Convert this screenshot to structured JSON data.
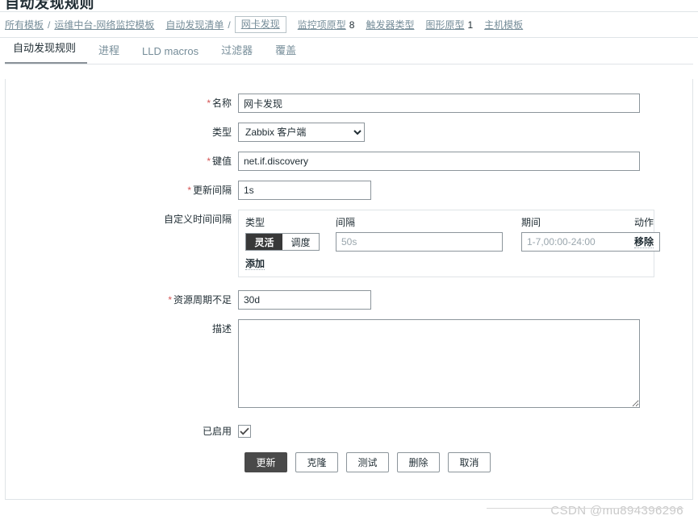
{
  "page": {
    "title": "自动发现规则"
  },
  "breadcrumb": {
    "items": [
      {
        "label": "所有模板",
        "link": true,
        "boxed": false,
        "count": ""
      },
      {
        "label": "运维中台-网络监控模板",
        "link": true,
        "boxed": false,
        "count": ""
      },
      {
        "label": "自动发现清单",
        "link": true,
        "boxed": false,
        "count": ""
      },
      {
        "label": "网卡发现",
        "link": true,
        "boxed": true,
        "count": ""
      },
      {
        "label": "监控项原型",
        "link": true,
        "boxed": false,
        "count": "8"
      },
      {
        "label": "触发器类型",
        "link": true,
        "boxed": false,
        "count": ""
      },
      {
        "label": "图形原型",
        "link": true,
        "boxed": false,
        "count": "1"
      },
      {
        "label": "主机模板",
        "link": true,
        "boxed": false,
        "count": ""
      }
    ],
    "separator": "/"
  },
  "tabs": [
    {
      "label": "自动发现规则",
      "active": true
    },
    {
      "label": "进程",
      "active": false
    },
    {
      "label": "LLD macros",
      "active": false
    },
    {
      "label": "过滤器",
      "active": false
    },
    {
      "label": "覆盖",
      "active": false
    }
  ],
  "form": {
    "name": {
      "label": "名称",
      "required": true,
      "value": "网卡发现",
      "placeholder": ""
    },
    "type": {
      "label": "类型",
      "required": false,
      "value": "Zabbix 客户端",
      "options": [
        "Zabbix 客户端"
      ]
    },
    "key": {
      "label": "键值",
      "required": true,
      "value": "net.if.discovery",
      "placeholder": ""
    },
    "update_interval": {
      "label": "更新间隔",
      "required": true,
      "value": "1s",
      "placeholder": ""
    },
    "custom_intervals": {
      "label": "自定义时间间隔",
      "headers": {
        "type": "类型",
        "interval": "间隔",
        "period": "期间",
        "action": "动作"
      },
      "rows": [
        {
          "type_options": [
            "灵活",
            "调度"
          ],
          "type_selected": "灵活",
          "interval_value": "",
          "interval_placeholder": "50s",
          "period_value": "",
          "period_placeholder": "1-7,00:00-24:00",
          "remove_label": "移除"
        }
      ],
      "add_label": "添加"
    },
    "lifetime": {
      "label": "资源周期不足",
      "required": true,
      "value": "30d",
      "placeholder": ""
    },
    "description": {
      "label": "描述",
      "required": false,
      "value": "",
      "placeholder": ""
    },
    "enabled": {
      "label": "已启用",
      "checked": true
    }
  },
  "actions": [
    {
      "label": "更新",
      "primary": true
    },
    {
      "label": "克隆",
      "primary": false
    },
    {
      "label": "测试",
      "primary": false
    },
    {
      "label": "删除",
      "primary": false
    },
    {
      "label": "取消",
      "primary": false
    }
  ],
  "watermark": {
    "text": "CSDN @mu894396296"
  },
  "colors": {
    "accent_dark": "#4a4a4a",
    "segment_active": "#383838",
    "required_star": "#d45353",
    "link": "#768d99",
    "border": "#dfe4e7",
    "input_border": "#8c959b"
  }
}
